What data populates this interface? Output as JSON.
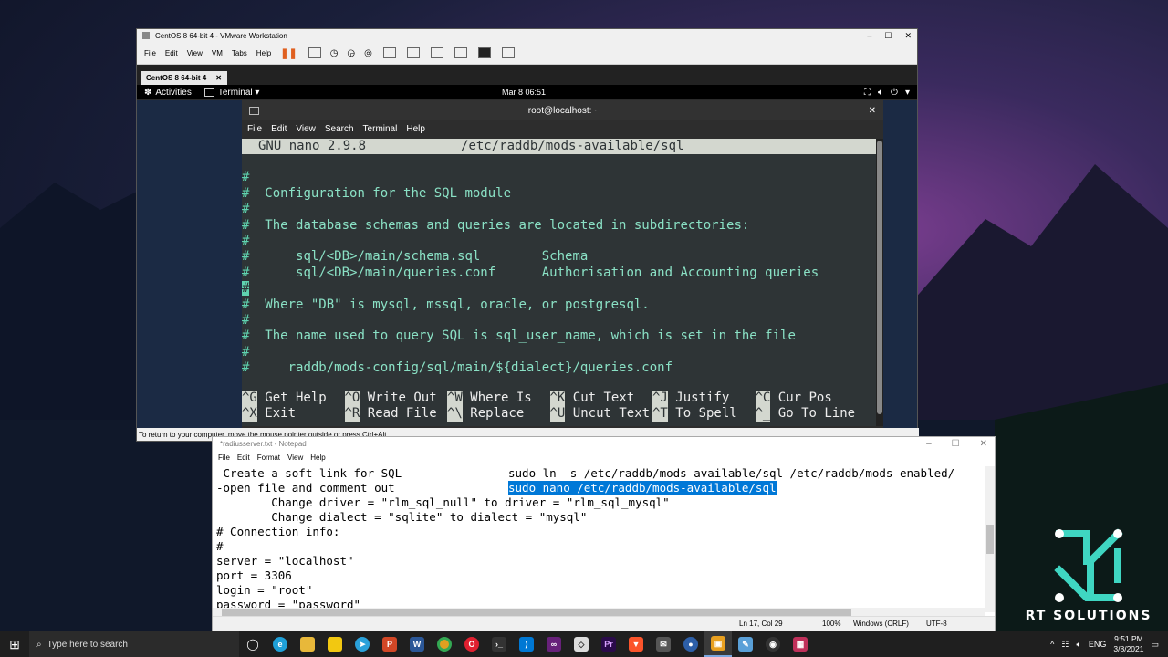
{
  "vmware": {
    "title": "CentOS 8 64-bit 4 - VMware Workstation",
    "menu": [
      "File",
      "Edit",
      "View",
      "VM",
      "Tabs",
      "Help"
    ],
    "tab": "CentOS 8 64-bit 4",
    "status": "To return to your computer, move the mouse pointer outside or press Ctrl+Alt."
  },
  "gnome": {
    "activities": "Activities",
    "app": "Terminal ▾",
    "clock": "Mar 8  06:51"
  },
  "terminal": {
    "title": "root@localhost:~",
    "menu": [
      "File",
      "Edit",
      "View",
      "Search",
      "Terminal",
      "Help"
    ],
    "nano_version": "GNU nano 2.9.8",
    "file_path": "/etc/raddb/mods-available/sql",
    "lines": [
      "",
      "#",
      "#  Configuration for the SQL module",
      "#",
      "#  The database schemas and queries are located in subdirectories:",
      "#",
      "#      sql/<DB>/main/schema.sql        Schema",
      "#      sql/<DB>/main/queries.conf      Authorisation and Accounting queries",
      "#",
      "#  Where \"DB\" is mysql, mssql, oracle, or postgresql.",
      "#",
      "#  The name used to query SQL is sql_user_name, which is set in the file",
      "#",
      "#     raddb/mods-config/sql/main/${dialect}/queries.conf"
    ],
    "shortcuts_row1": [
      {
        "key": "^G",
        "label": " Get Help"
      },
      {
        "key": "^O",
        "label": " Write Out"
      },
      {
        "key": "^W",
        "label": " Where Is"
      },
      {
        "key": "^K",
        "label": " Cut Text"
      },
      {
        "key": "^J",
        "label": " Justify"
      },
      {
        "key": "^C",
        "label": " Cur Pos"
      }
    ],
    "shortcuts_row2": [
      {
        "key": "^X",
        "label": " Exit"
      },
      {
        "key": "^R",
        "label": " Read File"
      },
      {
        "key": "^\\",
        "label": " Replace"
      },
      {
        "key": "^U",
        "label": " Uncut Text"
      },
      {
        "key": "^T",
        "label": " To Spell"
      },
      {
        "key": "^_",
        "label": " Go To Line"
      }
    ]
  },
  "notepad": {
    "title": "*radiusserver.txt - Notepad",
    "menu": [
      "File",
      "Edit",
      "Format",
      "View",
      "Help"
    ],
    "lines": [
      {
        "left": "-Create a soft link for SQL",
        "right": "sudo ln -s /etc/raddb/mods-available/sql /etc/raddb/mods-enabled/"
      },
      {
        "left": "-open file and comment out",
        "right": "sudo nano /etc/raddb/mods-available/sql"
      },
      {
        "left": "        Change driver = \"rlm_sql_null\" to driver = \"rlm_sql_mysql\"",
        "right": ""
      },
      {
        "left": "        Change dialect = \"sqlite\" to dialect = \"mysql\"",
        "right": ""
      },
      {
        "left": "# Connection info:",
        "right": ""
      },
      {
        "left": "#",
        "right": ""
      },
      {
        "left": "server = \"localhost\"",
        "right": ""
      },
      {
        "left": "port = 3306",
        "right": ""
      },
      {
        "left": "login = \"root\"",
        "right": ""
      },
      {
        "left": "password = \"password\"",
        "right": ""
      }
    ],
    "status": {
      "position": "Ln 17, Col 29",
      "zoom": "100%",
      "eol": "Windows (CRLF)",
      "encoding": "UTF-8"
    }
  },
  "taskbar": {
    "search_placeholder": "Type here to search",
    "language": "ENG",
    "time": "9:51 PM",
    "date": "3/8/2021"
  },
  "logo": {
    "text": "RT SOLUTIONS",
    "color": "#3fd6c2"
  }
}
